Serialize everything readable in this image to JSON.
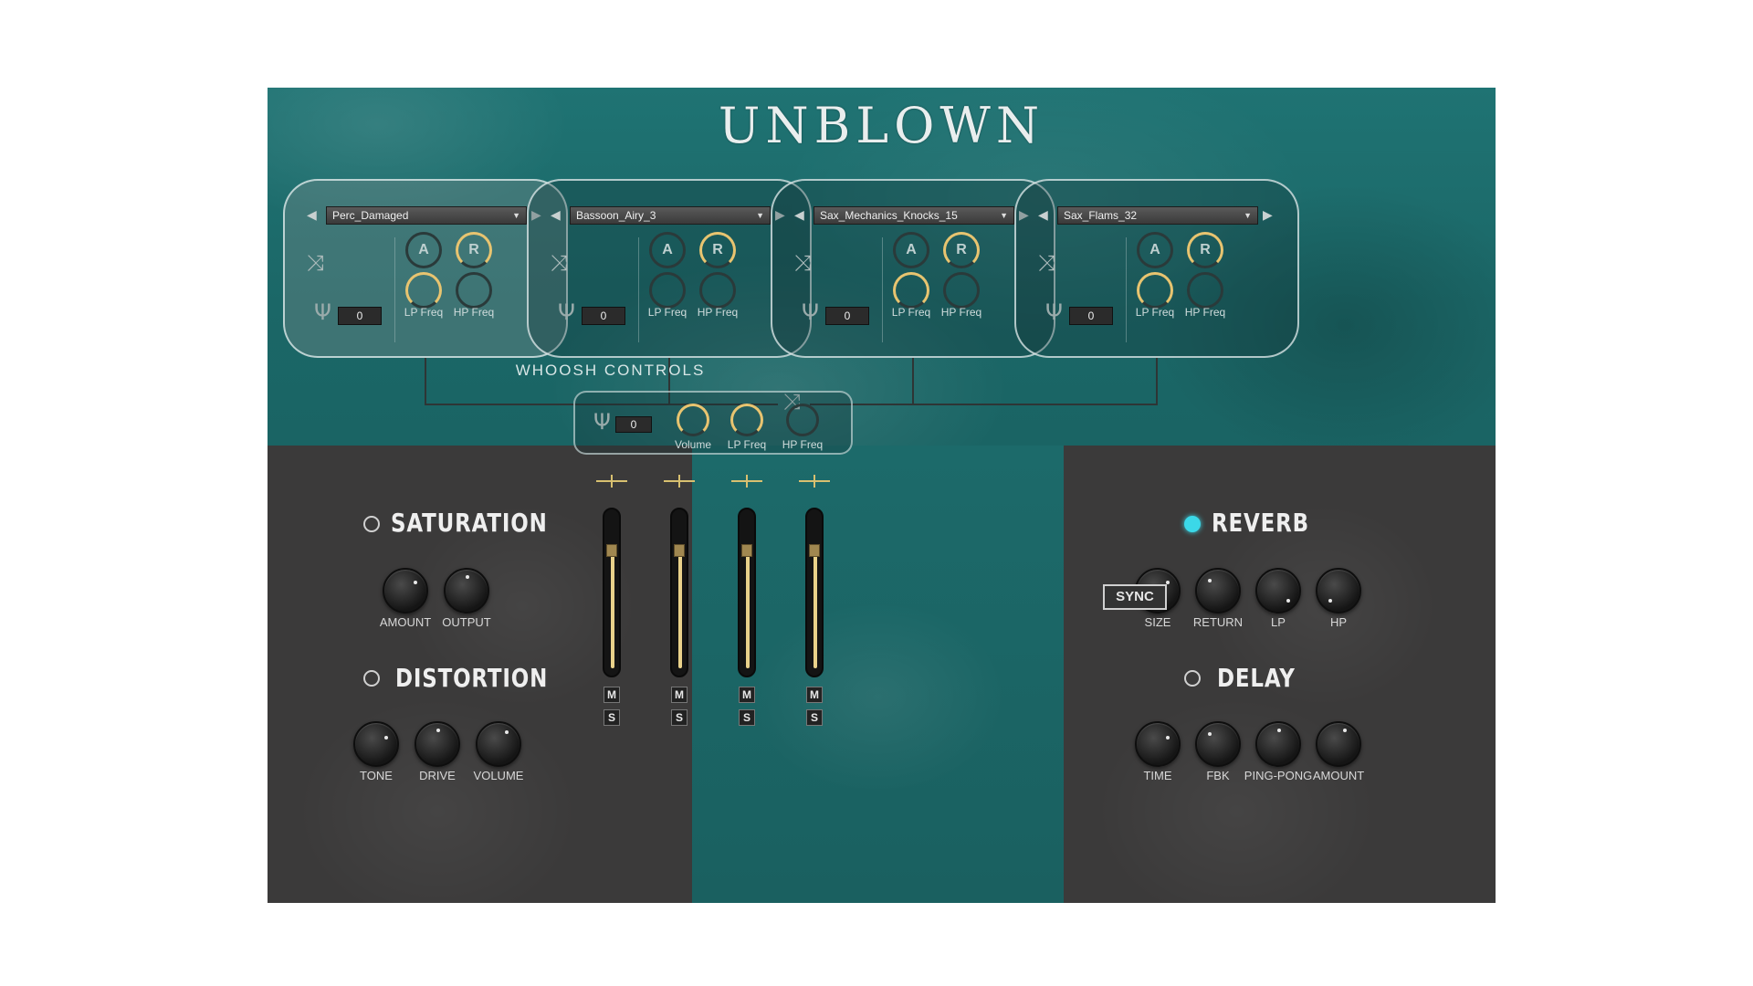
{
  "app": {
    "title": "UNBLOWN"
  },
  "modules": [
    {
      "sample": "Perc_Damaged",
      "tune": "0",
      "attack": "A",
      "release": "R",
      "lp_label": "LP Freq",
      "hp_label": "HP Freq"
    },
    {
      "sample": "Bassoon_Airy_3",
      "tune": "0",
      "attack": "A",
      "release": "R",
      "lp_label": "LP Freq",
      "hp_label": "HP Freq"
    },
    {
      "sample": "Sax_Mechanics_Knocks_15",
      "tune": "0",
      "attack": "A",
      "release": "R",
      "lp_label": "LP Freq",
      "hp_label": "HP Freq"
    },
    {
      "sample": "Sax_Flams_32",
      "tune": "0",
      "attack": "A",
      "release": "R",
      "lp_label": "LP Freq",
      "hp_label": "HP Freq"
    }
  ],
  "icons": {
    "shuffle": "shuffle-icon",
    "tuning_fork": "tuning-fork-icon",
    "arrow_left": "arrow-left-icon",
    "arrow_right": "arrow-right-icon"
  },
  "whoosh": {
    "title": "WHOOSH CONTROLS",
    "tune": "0",
    "volume_label": "Volume",
    "lp_label": "LP Freq",
    "hp_label": "HP Freq"
  },
  "saturation": {
    "title": "SATURATION",
    "amount": "AMOUNT",
    "output": "OUTPUT",
    "enabled": false
  },
  "distortion": {
    "title": "DISTORTION",
    "tone": "TONE",
    "drive": "DRIVE",
    "volume": "VOLUME",
    "enabled": false
  },
  "reverb": {
    "title": "REVERB",
    "size": "SIZE",
    "return": "RETURN",
    "lp": "LP",
    "hp": "HP",
    "enabled": true
  },
  "delay": {
    "title": "DELAY",
    "sync": "SYNC",
    "time": "TIME",
    "fbk": "FBK",
    "pingpong": "PING-PONG",
    "amount": "AMOUNT",
    "enabled": false
  },
  "mixer": {
    "channels": [
      {
        "mute": "M",
        "solo": "S",
        "level": 0.78
      },
      {
        "mute": "M",
        "solo": "S",
        "level": 0.78
      },
      {
        "mute": "M",
        "solo": "S",
        "level": 0.78
      },
      {
        "mute": "M",
        "solo": "S",
        "level": 0.78
      }
    ]
  },
  "colors": {
    "accent_gold": "#e8c470",
    "reverb_on": "#3bd8e8",
    "teal": "#1d6a6a",
    "panel_dark": "#3b3a3a"
  }
}
